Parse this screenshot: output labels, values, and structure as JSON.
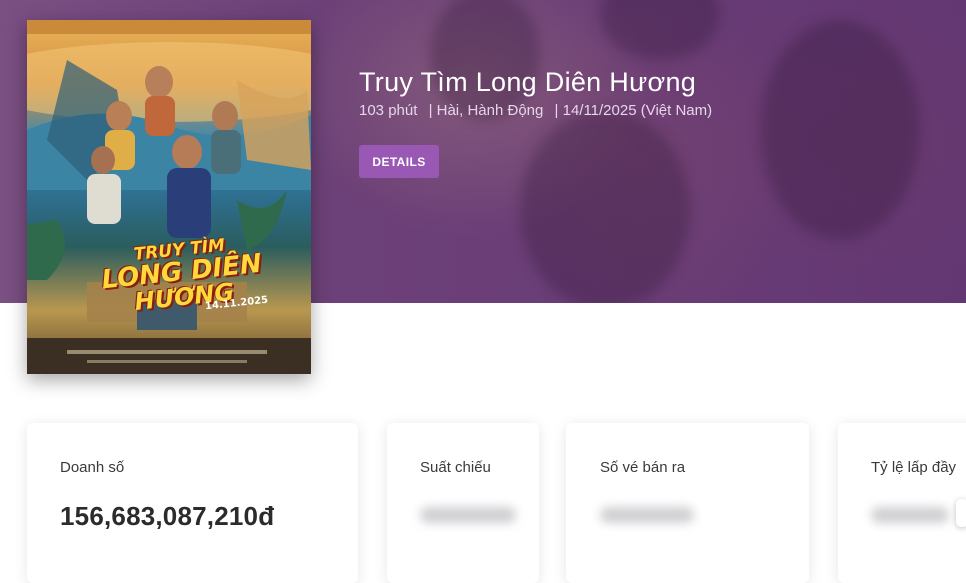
{
  "movie": {
    "title": "Truy Tìm Long Diên Hương",
    "duration": "103 phút",
    "genres": "| Hài, Hành Động",
    "release": "| 14/11/2025 (Việt Nam)",
    "details_label": "DETAILS"
  },
  "poster": {
    "title_line1": "TRUY TÌM",
    "title_line2": "LONG DIÊN",
    "title_line3": "HƯƠNG",
    "date": "14.11.2025"
  },
  "stats": [
    {
      "label": "Doanh số",
      "value": "156,683,087,210đ"
    },
    {
      "label": "Suất chiếu",
      "value": ""
    },
    {
      "label": "Số vé bán ra",
      "value": ""
    },
    {
      "label": "Tỷ lệ lấp đầy",
      "value": ""
    }
  ],
  "colors": {
    "hero_bg": "#6c4078",
    "accent": "#9a58b5"
  }
}
